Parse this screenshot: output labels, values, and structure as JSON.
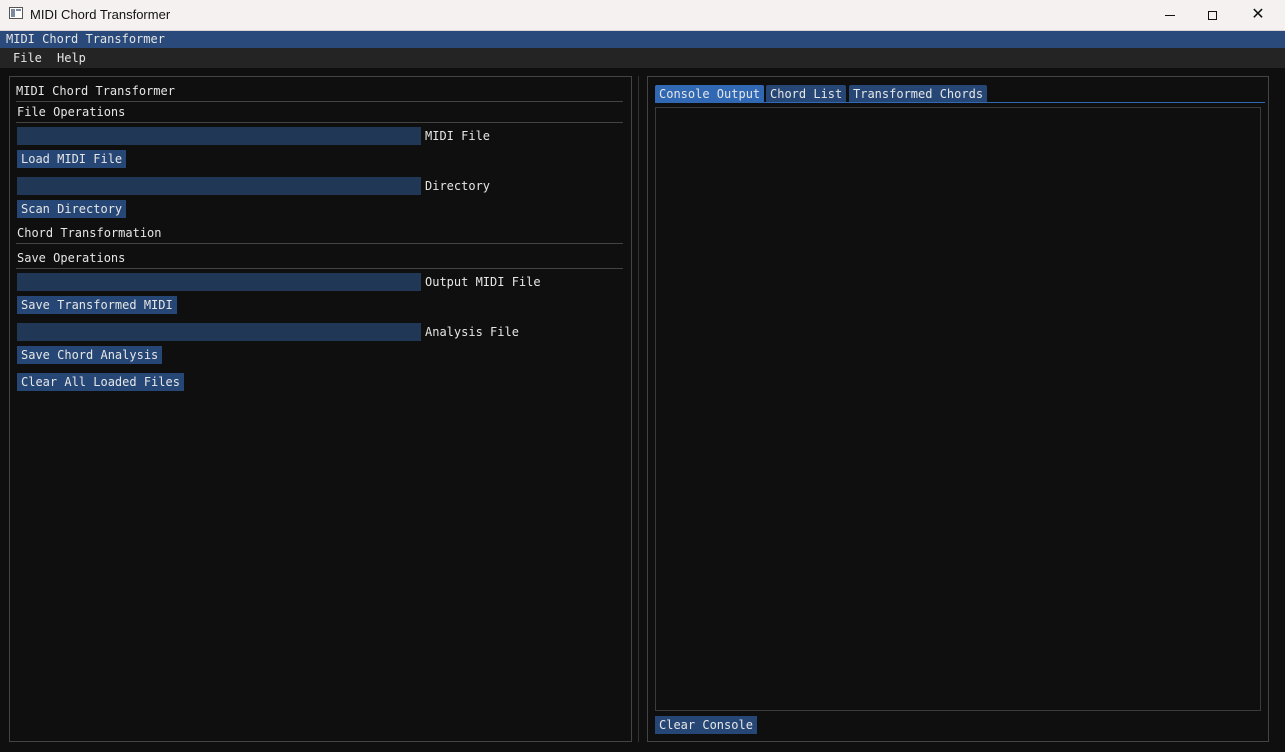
{
  "window": {
    "title": "MIDI Chord Transformer",
    "icon": "app-window-icon"
  },
  "imgui_window": {
    "title": "MIDI Chord Transformer"
  },
  "menu": {
    "items": [
      "File",
      "Help"
    ]
  },
  "left": {
    "heading": "MIDI Chord Transformer",
    "file_ops": {
      "header": "File Operations",
      "midi_file_label": "MIDI File",
      "midi_file_value": "",
      "load_button": "Load MIDI File",
      "directory_label": "Directory",
      "directory_value": "",
      "scan_button": "Scan Directory"
    },
    "chord_transformation_header": "Chord Transformation",
    "save_ops": {
      "header": "Save Operations",
      "output_label": "Output MIDI File",
      "output_value": "",
      "save_transformed_button": "Save Transformed MIDI",
      "analysis_label": "Analysis File",
      "analysis_value": "",
      "save_analysis_button": "Save Chord Analysis"
    },
    "clear_all_button": "Clear All Loaded Files"
  },
  "right": {
    "tabs": [
      {
        "label": "Console Output",
        "active": true
      },
      {
        "label": "Chord List",
        "active": false
      },
      {
        "label": "Transformed Chords",
        "active": false
      }
    ],
    "console_text": "",
    "clear_console_button": "Clear Console"
  },
  "colors": {
    "background": "#0f0f0f",
    "title_bar": "#294a7a",
    "button": "#264775",
    "input": "#213756",
    "active_tab": "#3168b4"
  }
}
